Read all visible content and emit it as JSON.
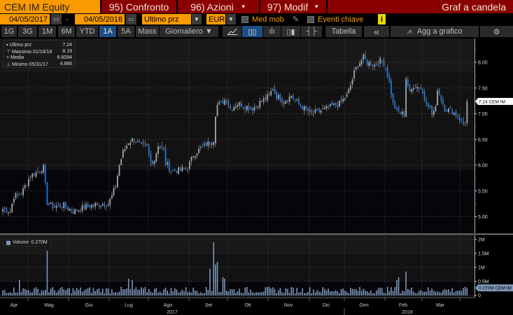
{
  "header": {
    "ticker": "CEM IM Equity",
    "compare": "95) Confronto",
    "actions": "96) Azioni",
    "modify": "97) Modif",
    "chart_type": "Graf a candela"
  },
  "controls": {
    "start_date": "04/05/2017",
    "dash": "-",
    "end_date": "04/05/2018",
    "field": "Ultimo prz",
    "currency": "EUR",
    "moving_avg": "Med mob",
    "key_events": "Eventi chiave",
    "info": "i"
  },
  "toolbar": {
    "periods": [
      "1G",
      "3G",
      "1M",
      "6M",
      "YTD",
      "1A",
      "5A",
      "Mass"
    ],
    "selected_period": "1A",
    "frequency": "Giornaliero ▼",
    "table": "Tabella",
    "collapse": "«",
    "add_to_chart": "Agg a grafico"
  },
  "legend": {
    "last_label": "Ultimo prz",
    "last_value": "7.24",
    "high_label": "Massimo 01/16/18",
    "high_value": "8.19",
    "avg_label": "Media",
    "avg_value": "6.6094",
    "low_label": "Minimo 05/31/17",
    "low_value": "4.986"
  },
  "volume_legend": {
    "label": "Volume",
    "value": "0.270M"
  },
  "colors": {
    "up": "#a8a8a8",
    "down": "#1e78e6",
    "volume": "#7d97b8",
    "accent": "#fa9a00",
    "header": "#8a0000"
  },
  "chart_data": {
    "type": "candlestick",
    "price_axis": {
      "ticks": [
        5.0,
        5.5,
        6.0,
        6.5,
        7.0,
        7.5,
        8.0
      ],
      "tick_labels": [
        "5.00",
        "5.50",
        "6.00",
        "6.50",
        "7.00",
        "7.50",
        "8.00"
      ],
      "ylim": [
        4.75,
        8.45
      ]
    },
    "last_price_label": "7.24 CEM IM",
    "volume_axis": {
      "ticks": [
        0,
        0.5,
        1,
        1.5,
        2
      ],
      "tick_labels": [
        "0",
        "0.5M",
        "1M",
        "1.5M",
        "2M"
      ],
      "unit": "M"
    },
    "last_volume_label": "0.270M CEM IM",
    "months": [
      "Apr",
      "Mag",
      "Giu",
      "Lug",
      "Ago",
      "Set",
      "Ott",
      "Nov",
      "Dic",
      "Gen",
      "Feb",
      "Mar"
    ],
    "years": [
      "2017",
      "2018"
    ],
    "trading_days": 252,
    "close_anchors": [
      [
        0,
        5.15
      ],
      [
        4,
        5.1
      ],
      [
        6,
        5.4
      ],
      [
        10,
        5.45
      ],
      [
        15,
        5.8
      ],
      [
        22,
        5.95
      ],
      [
        24,
        5.27
      ],
      [
        27,
        5.2
      ],
      [
        33,
        5.22
      ],
      [
        38,
        5.1
      ],
      [
        45,
        5.2
      ],
      [
        53,
        5.25
      ],
      [
        57,
        5.25
      ],
      [
        59,
        5.4
      ],
      [
        61,
        5.6
      ],
      [
        63,
        6.0
      ],
      [
        65,
        6.25
      ],
      [
        68,
        6.45
      ],
      [
        71,
        6.52
      ],
      [
        74,
        6.4
      ],
      [
        78,
        6.35
      ],
      [
        80,
        6.05
      ],
      [
        82,
        6.1
      ],
      [
        84,
        6.4
      ],
      [
        87,
        6.3
      ],
      [
        88,
        6.05
      ],
      [
        91,
        5.9
      ],
      [
        95,
        5.9
      ],
      [
        100,
        5.95
      ],
      [
        103,
        6.2
      ],
      [
        106,
        6.3
      ],
      [
        110,
        6.4
      ],
      [
        114,
        6.5
      ],
      [
        115,
        7.0
      ],
      [
        116,
        7.17
      ],
      [
        118,
        7.2
      ],
      [
        121,
        7.3
      ],
      [
        123,
        7.1
      ],
      [
        127,
        7.2
      ],
      [
        131,
        7.15
      ],
      [
        135,
        7.1
      ],
      [
        140,
        7.25
      ],
      [
        144,
        7.35
      ],
      [
        146,
        7.5
      ],
      [
        148,
        7.35
      ],
      [
        152,
        7.25
      ],
      [
        156,
        7.35
      ],
      [
        161,
        7.15
      ],
      [
        167,
        7.0
      ],
      [
        171,
        7.05
      ],
      [
        175,
        7.1
      ],
      [
        178,
        7.15
      ],
      [
        182,
        7.2
      ],
      [
        186,
        7.35
      ],
      [
        188,
        7.55
      ],
      [
        190,
        7.8
      ],
      [
        192,
        7.95
      ],
      [
        195,
        8.1
      ],
      [
        197,
        8.0
      ],
      [
        201,
        7.95
      ],
      [
        205,
        8.05
      ],
      [
        207,
        7.9
      ],
      [
        209,
        7.6
      ],
      [
        211,
        7.2
      ],
      [
        213,
        7.05
      ],
      [
        215,
        7.0
      ],
      [
        217,
        7.0
      ],
      [
        218,
        7.7
      ],
      [
        220,
        7.4
      ],
      [
        222,
        7.55
      ],
      [
        226,
        7.5
      ],
      [
        228,
        7.3
      ],
      [
        230,
        7.2
      ],
      [
        232,
        7.0
      ],
      [
        234,
        7.1
      ],
      [
        235,
        7.5
      ],
      [
        237,
        7.3
      ],
      [
        239,
        7.1
      ],
      [
        243,
        7.05
      ],
      [
        246,
        6.95
      ],
      [
        249,
        6.8
      ],
      [
        250,
        6.85
      ],
      [
        251,
        7.24
      ]
    ],
    "volume_spikes_M": [
      [
        9,
        0.55
      ],
      [
        24,
        1.6
      ],
      [
        68,
        0.6
      ],
      [
        70,
        0.55
      ],
      [
        112,
        0.95
      ],
      [
        114,
        1.9
      ],
      [
        115,
        1.1
      ],
      [
        116,
        1.2
      ],
      [
        119,
        0.65
      ],
      [
        120,
        0.6
      ],
      [
        218,
        0.85
      ],
      [
        213,
        0.55
      ],
      [
        214,
        0.65
      ]
    ],
    "volume_base_M": 0.2
  }
}
